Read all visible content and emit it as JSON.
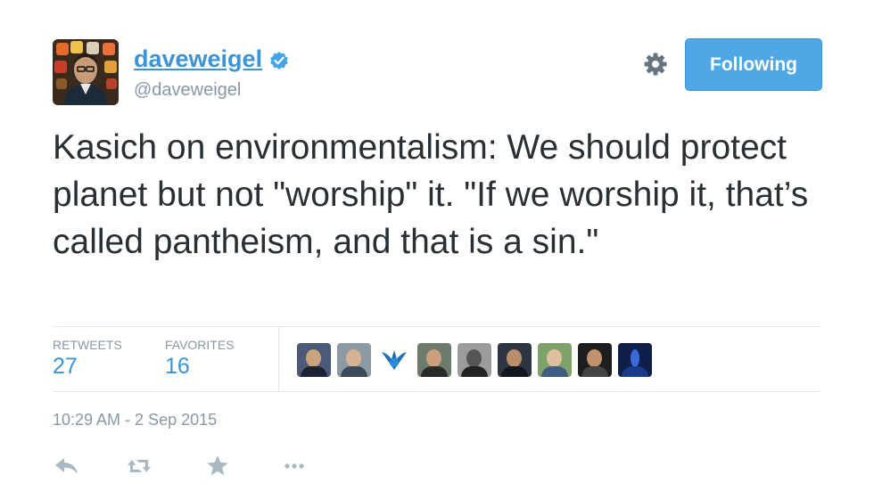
{
  "user": {
    "display_name": "daveweigel",
    "screen_name": "@daveweigel",
    "verified": true
  },
  "header": {
    "follow_label": "Following"
  },
  "tweet": {
    "text": "Kasich on environmentalism: We should protect planet but not \"worship\" it. \"If we worship it, that’s called pantheism, and that is a sin.\""
  },
  "stats": {
    "retweets_label": "RETWEETS",
    "retweets_value": "27",
    "favorites_label": "FAVORITES",
    "favorites_value": "16",
    "favoriter_avatar_count": 9
  },
  "meta": {
    "timestamp": "10:29 AM - 2 Sep 2015"
  },
  "actions": [
    "reply-icon",
    "retweet-icon",
    "favorite-icon",
    "more-icon"
  ],
  "colors": {
    "link_blue": "#3b94d9",
    "follow_button": "#4fa7e5",
    "muted_gray": "#8899a6",
    "text": "#292f33",
    "divider": "#e1e8ed"
  }
}
